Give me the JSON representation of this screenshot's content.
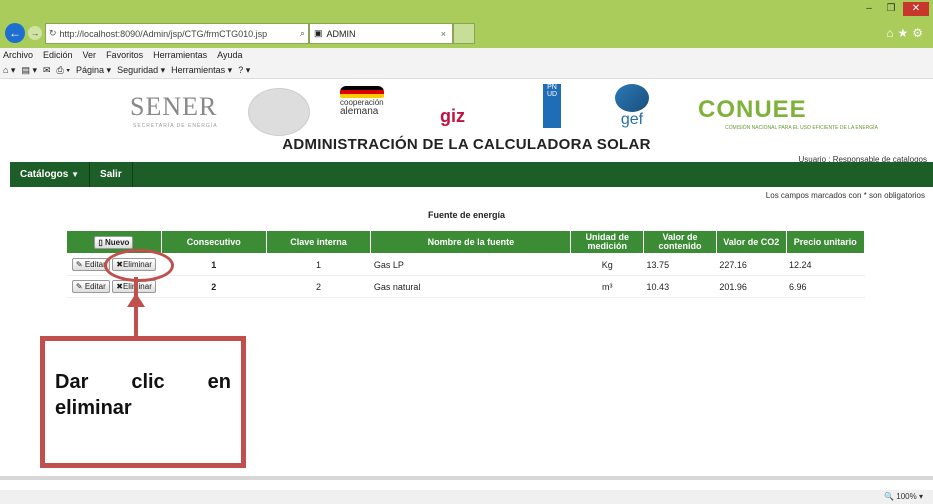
{
  "browser": {
    "url": "http://localhost:8090/Admin/jsp/CTG/frmCTG010.jsp",
    "tab_title": "ADMIN",
    "menu": [
      "Archivo",
      "Edición",
      "Ver",
      "Favoritos",
      "Herramientas",
      "Ayuda"
    ],
    "commands": [
      "Página ▾",
      "Seguridad ▾",
      "Herramientas ▾"
    ],
    "zoom": "100%"
  },
  "header": {
    "sener": "SENER",
    "sener_sub": "SECRETARÍA DE ENERGÍA",
    "coop_line1": "cooperación",
    "coop_line2": "alemana",
    "giz": "giz",
    "undp": "PN UD",
    "gef": "gef",
    "conuee": "CONUEE",
    "conuee_sub": "COMISIÓN NACIONAL PARA EL USO EFICIENTE DE LA ENERGÍA",
    "title": "ADMINISTRACIÓN DE LA CALCULADORA SOLAR",
    "usuario": "Usuario : Responsable de catalogos"
  },
  "nav": {
    "catalogos": "Catálogos",
    "salir": "Salir"
  },
  "required_note": "Los campos marcados con * son obligatorios",
  "section_title": "Fuente de energía",
  "table": {
    "new_button": "Nuevo",
    "headers": [
      "Consecutivo",
      "Clave interna",
      "Nombre de la fuente",
      "Unidad de medición",
      "Valor de contenido",
      "Valor de CO2",
      "Precio unitario"
    ],
    "edit_label": "Editar",
    "delete_label": "Eliminar",
    "rows": [
      {
        "consecutivo": "1",
        "clave": "1",
        "nombre": "Gas LP",
        "unidad": "Kg",
        "contenido": "13.75",
        "co2": "227.16",
        "precio": "12.24"
      },
      {
        "consecutivo": "2",
        "clave": "2",
        "nombre": "Gas natural",
        "unidad": "m³",
        "contenido": "10.43",
        "co2": "201.96",
        "precio": "6.96"
      }
    ]
  },
  "callout": {
    "text": "Dar clic en eliminar",
    "color": "#c0504d"
  }
}
